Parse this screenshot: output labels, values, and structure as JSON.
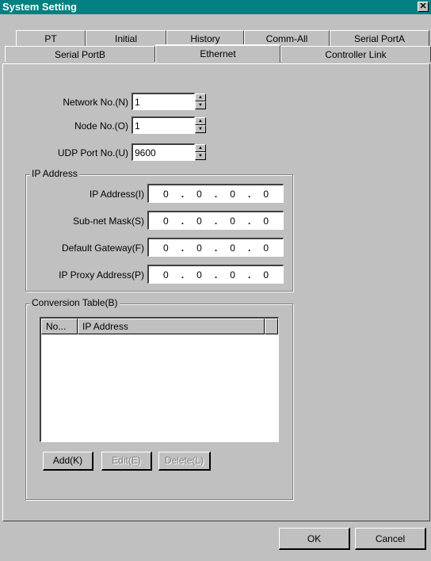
{
  "window": {
    "title": "System Setting",
    "close_glyph": "✕"
  },
  "tabs_row1": [
    "PT",
    "Initial",
    "History",
    "Comm-All",
    "Serial PortA"
  ],
  "tabs_row2": [
    "Serial PortB",
    "Ethernet",
    "Controller Link"
  ],
  "selected_tab": "Ethernet",
  "network": {
    "network_no_label": "Network No.(N)",
    "network_no_value": "1",
    "node_no_label": "Node No.(O)",
    "node_no_value": "1",
    "udp_port_label": "UDP Port No.(U)",
    "udp_port_value": "9600"
  },
  "ip_group": {
    "title": "IP Address",
    "rows": [
      {
        "label": "IP Address(I)",
        "octets": [
          "0",
          "0",
          "0",
          "0"
        ]
      },
      {
        "label": "Sub-net Mask(S)",
        "octets": [
          "0",
          "0",
          "0",
          "0"
        ]
      },
      {
        "label": "Default Gateway(F)",
        "octets": [
          "0",
          "0",
          "0",
          "0"
        ]
      },
      {
        "label": "IP Proxy Address(P)",
        "octets": [
          "0",
          "0",
          "0",
          "0"
        ]
      }
    ]
  },
  "conversion": {
    "title": "Conversion Table(B)",
    "col_no": "No...",
    "col_ip": "IP Address",
    "add": "Add(K)",
    "edit": "Edit(E)",
    "delete": "Delete(L)"
  },
  "footer": {
    "ok": "OK",
    "cancel": "Cancel"
  }
}
